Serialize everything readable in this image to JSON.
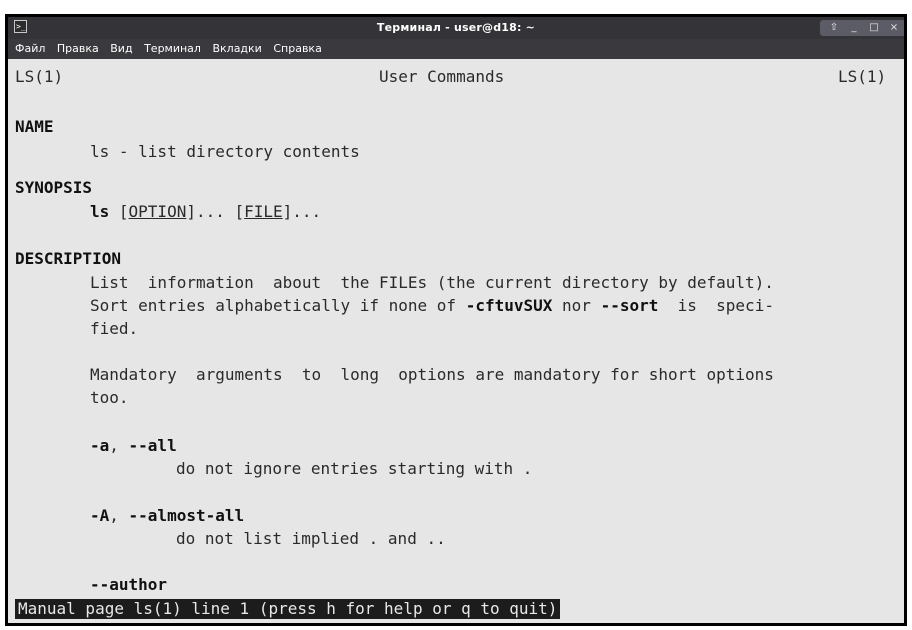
{
  "window": {
    "title": "Терминал - user@d18: ~",
    "controls": {
      "pin": "⇧",
      "minimize": "_",
      "maximize": "□",
      "close": "×"
    }
  },
  "menubar": {
    "items": [
      "Файл",
      "Правка",
      "Вид",
      "Терминал",
      "Вкладки",
      "Справка"
    ]
  },
  "man": {
    "header_left": "LS(1)",
    "header_center": "User Commands",
    "header_right": "LS(1)",
    "name_heading": "NAME",
    "name_text": "ls - list directory contents",
    "synopsis_heading": "SYNOPSIS",
    "synopsis_cmd": "ls",
    "synopsis_open1": " [",
    "synopsis_arg1": "OPTION",
    "synopsis_mid": "]... [",
    "synopsis_arg2": "FILE",
    "synopsis_close": "]...",
    "description_heading": "DESCRIPTION",
    "desc_line1": "List  information  about  the FILEs (the current directory by default).",
    "desc_line2_a": "Sort entries alphabetically if none of ",
    "desc_line2_b": "-cftuvSUX",
    "desc_line2_c": " nor ",
    "desc_line2_d": "--sort",
    "desc_line2_e": "  is  speci-",
    "desc_line3": "fied.",
    "mandatory_line1": "Mandatory  arguments  to  long  options are mandatory for short options",
    "mandatory_line2": "too.",
    "opt_a_short": "-a",
    "opt_a_sep": ", ",
    "opt_a_long": "--all",
    "opt_a_desc": "do not ignore entries starting with .",
    "opt_A_short": "-A",
    "opt_A_sep": ", ",
    "opt_A_long": "--almost-all",
    "opt_A_desc": "do not list implied . and ..",
    "opt_author": "--author"
  },
  "status": "Manual page ls(1) line 1 (press h for help or q to quit)"
}
